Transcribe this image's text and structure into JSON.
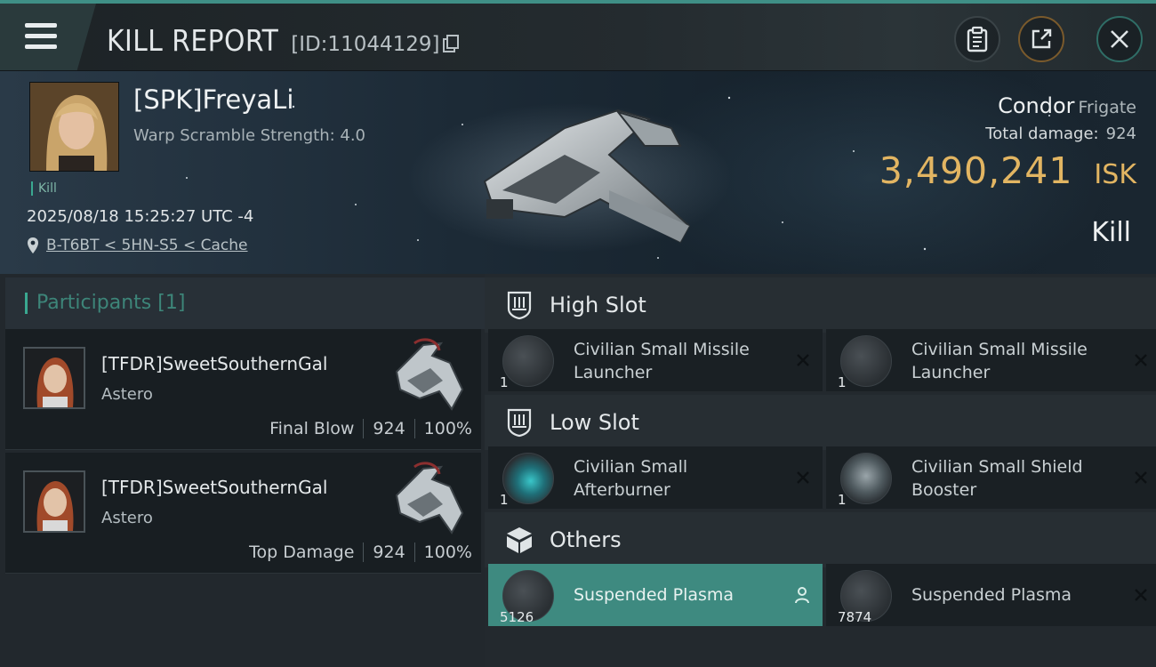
{
  "header": {
    "title": "KILL REPORT",
    "report_id": "[ID:11044129]",
    "icons": {
      "menu": "menu-icon",
      "copy": "copy-icon",
      "clipboard": "clipboard-icon",
      "share": "share-icon",
      "close": "close-icon"
    }
  },
  "victim": {
    "name": "[SPK]FreyaLi",
    "detail": "Warp Scramble Strength: 4.0",
    "tag": "Kill",
    "timestamp": "2025/08/18 15:25:27 UTC -4",
    "location": "B-T6BT < 5HN-S5 < Cache",
    "ship_name": "Condor",
    "ship_class": "Frigate",
    "total_damage_label": "Total damage:",
    "total_damage_value": "924",
    "isk_value": "3,490,241",
    "isk_unit": "ISK",
    "result": "Kill"
  },
  "participants": {
    "title": "Participants",
    "count": "[1]",
    "items": [
      {
        "name": "[TFDR]SweetSouthernGal",
        "ship": "Astero",
        "role": "Final Blow",
        "damage": "924",
        "percent": "100%"
      },
      {
        "name": "[TFDR]SweetSouthernGal",
        "ship": "Astero",
        "role": "Top Damage",
        "damage": "924",
        "percent": "100%"
      }
    ]
  },
  "fitting": {
    "high": {
      "title": "High Slot",
      "items": [
        {
          "name": "Civilian Small Missile Launcher",
          "qty": "1"
        },
        {
          "name": "Civilian Small Missile Launcher",
          "qty": "1"
        }
      ]
    },
    "low": {
      "title": "Low Slot",
      "items": [
        {
          "name": "Civilian Small Afterburner",
          "qty": "1"
        },
        {
          "name": "Civilian Small Shield Booster",
          "qty": "1"
        }
      ]
    },
    "others": {
      "title": "Others",
      "items": [
        {
          "name": "Suspended Plasma",
          "qty": "5126",
          "state": "dropped"
        },
        {
          "name": "Suspended Plasma",
          "qty": "7874",
          "state": "destroyed"
        }
      ]
    }
  },
  "colors": {
    "accent": "#3aa890",
    "isk": "#e2b562",
    "dropped_bg": "#3e8a80"
  }
}
